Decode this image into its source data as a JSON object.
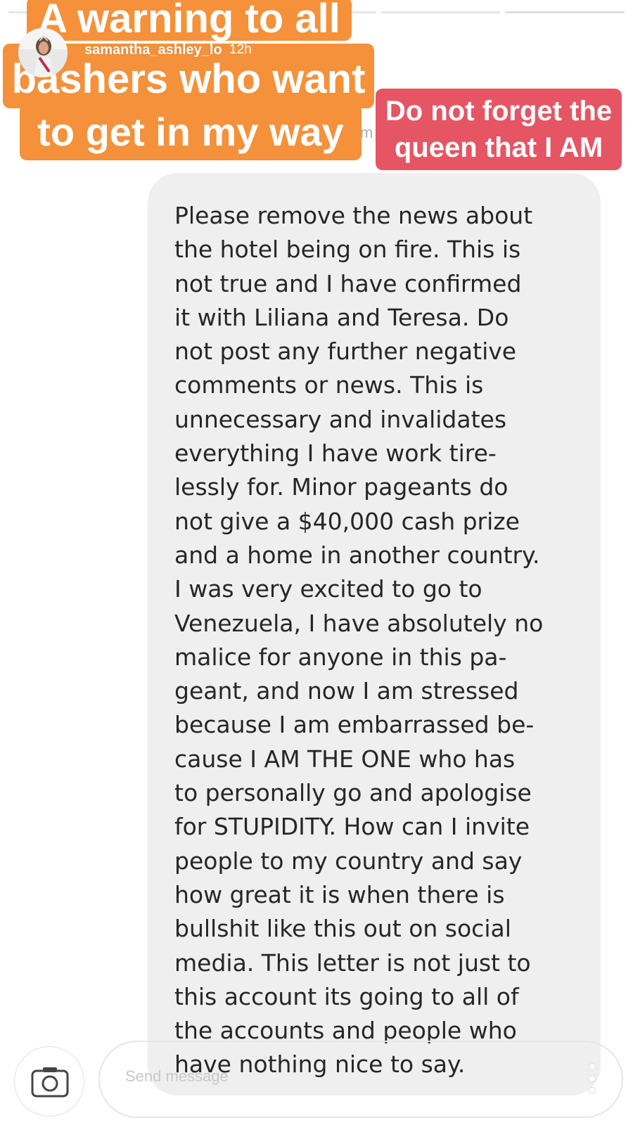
{
  "story": {
    "username": "samantha_ashley_lo",
    "time_ago": "12h",
    "progress_segments": [
      {
        "state": "viewed"
      },
      {
        "state": "viewed"
      },
      {
        "state": "viewed"
      },
      {
        "state": "current"
      },
      {
        "state": "upcoming"
      }
    ]
  },
  "stickers": {
    "orange_line1": "A warning to all",
    "orange_line2": "bashers who want",
    "orange_line3": "to get in my way",
    "red_line1": "Do not forget the",
    "red_line2": "queen that I AM",
    "orange_color": "#f4913a",
    "red_color": "#e55564"
  },
  "partial_text": "m",
  "message": {
    "lines": [
      "Please remove the news about",
      "the hotel being on fire. This is",
      "not true and I have confirmed",
      "it with Liliana and Teresa. Do",
      "not post any further negative",
      "comments or news. This is",
      "unnecessary and invalidates",
      "everything I have work tire-",
      "lessly for. Minor pageants do",
      "not give a $40,000 cash prize",
      "and a home in another country.",
      "I was very excited to go to",
      "Venezuela, I have absolutely no",
      "malice for anyone in this pa-",
      "geant, and now I am stressed",
      "because I am embarrassed be-",
      "cause I AM THE ONE who has",
      "to personally go and apologise",
      "for STUPIDITY. How can I invite",
      "people to my country and say",
      "how great it is when there is",
      "bullshit like this out on social",
      "media. This letter is not just to",
      "this account its going to all of",
      "the accounts and people who",
      "have nothing nice to say."
    ]
  },
  "reply": {
    "placeholder": "Send message",
    "camera_icon": "camera-icon",
    "more_icon": "more-options-icon"
  }
}
